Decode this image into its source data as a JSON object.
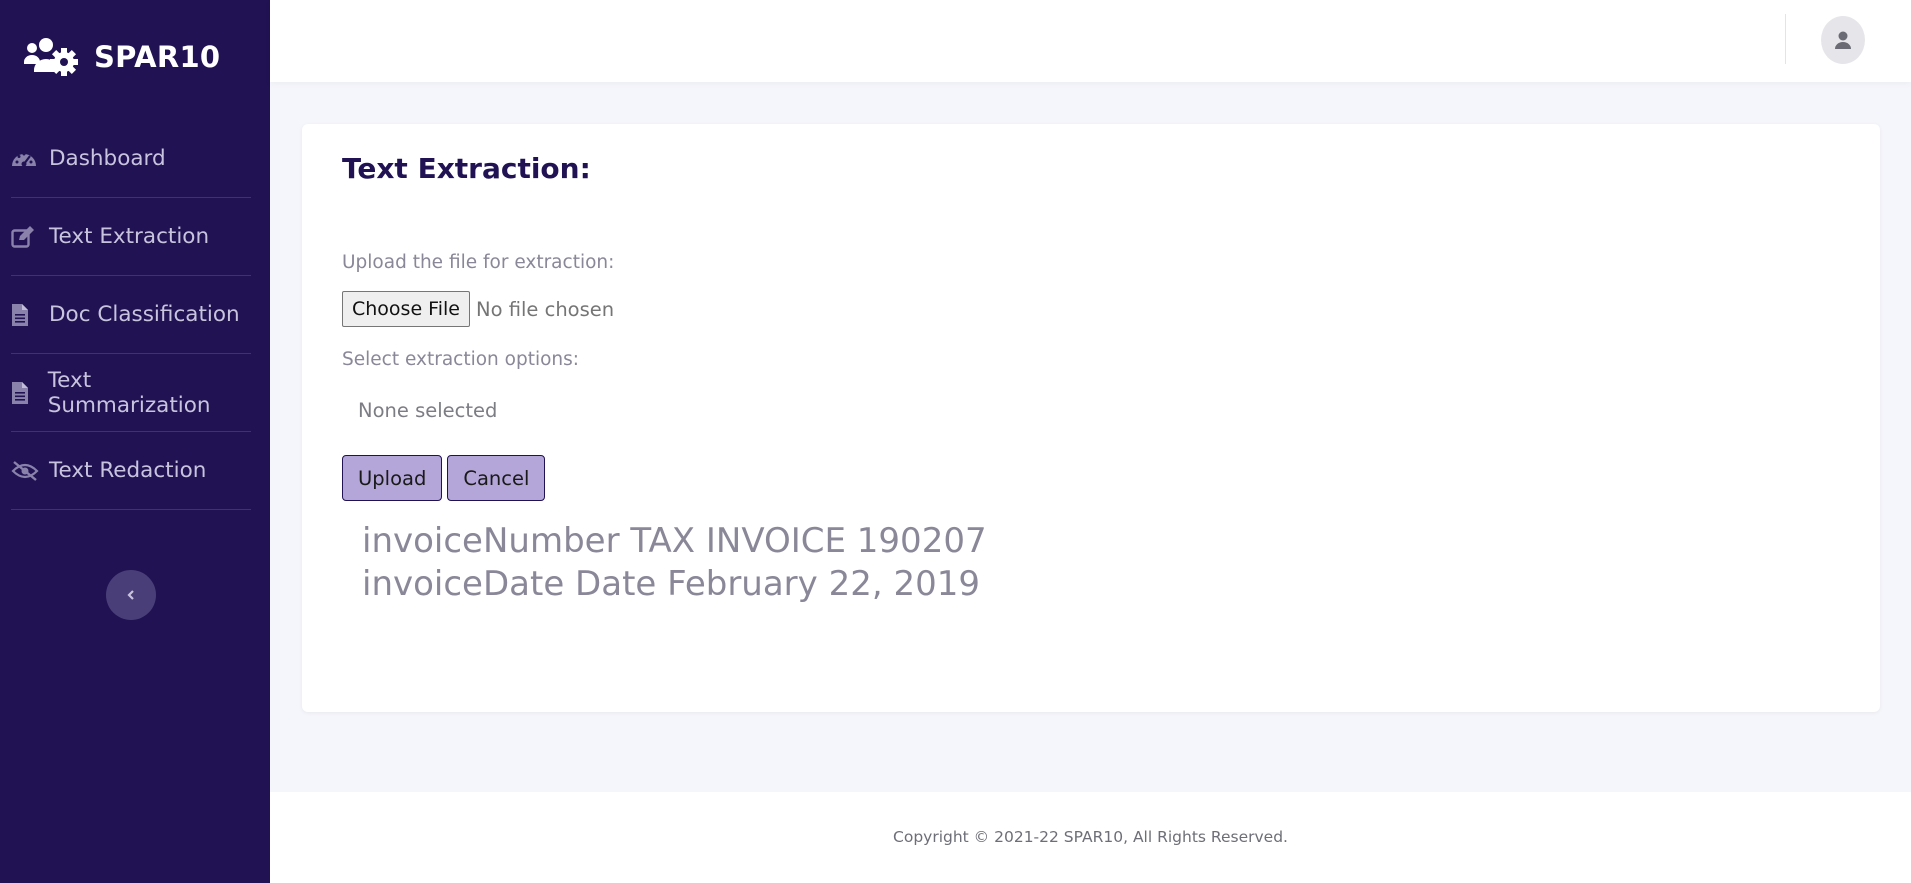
{
  "brand": {
    "name": "SPAR10",
    "logo_icon": "users-gear-icon"
  },
  "sidebar": {
    "items": [
      {
        "label": "Dashboard",
        "icon": "tachometer-icon"
      },
      {
        "label": "Text Extraction",
        "icon": "edit-icon"
      },
      {
        "label": "Doc Classification",
        "icon": "file-text-icon"
      },
      {
        "label": "Text Summarization",
        "icon": "file-text-icon"
      },
      {
        "label": "Text Redaction",
        "icon": "eye-slash-icon"
      }
    ],
    "collapse_icon": "chevron-left-icon"
  },
  "topbar": {
    "avatar_icon": "user-icon"
  },
  "main": {
    "title": "Text Extraction:",
    "upload_label": "Upload the file for extraction:",
    "choose_file_label": "Choose File",
    "file_status": "No file chosen",
    "options_label": "Select extraction options:",
    "options_selected": "None selected",
    "upload_button": "Upload",
    "cancel_button": "Cancel",
    "results": [
      "invoiceNumber TAX INVOICE 190207",
      "invoiceDate Date February 22, 2019"
    ]
  },
  "footer": {
    "copyright": "Copyright © 2021-22 SPAR10, All Rights Reserved."
  },
  "colors": {
    "sidebar_bg": "#201253",
    "accent": "#b4a6d8",
    "title": "#201253",
    "muted_text": "#8a8798"
  }
}
